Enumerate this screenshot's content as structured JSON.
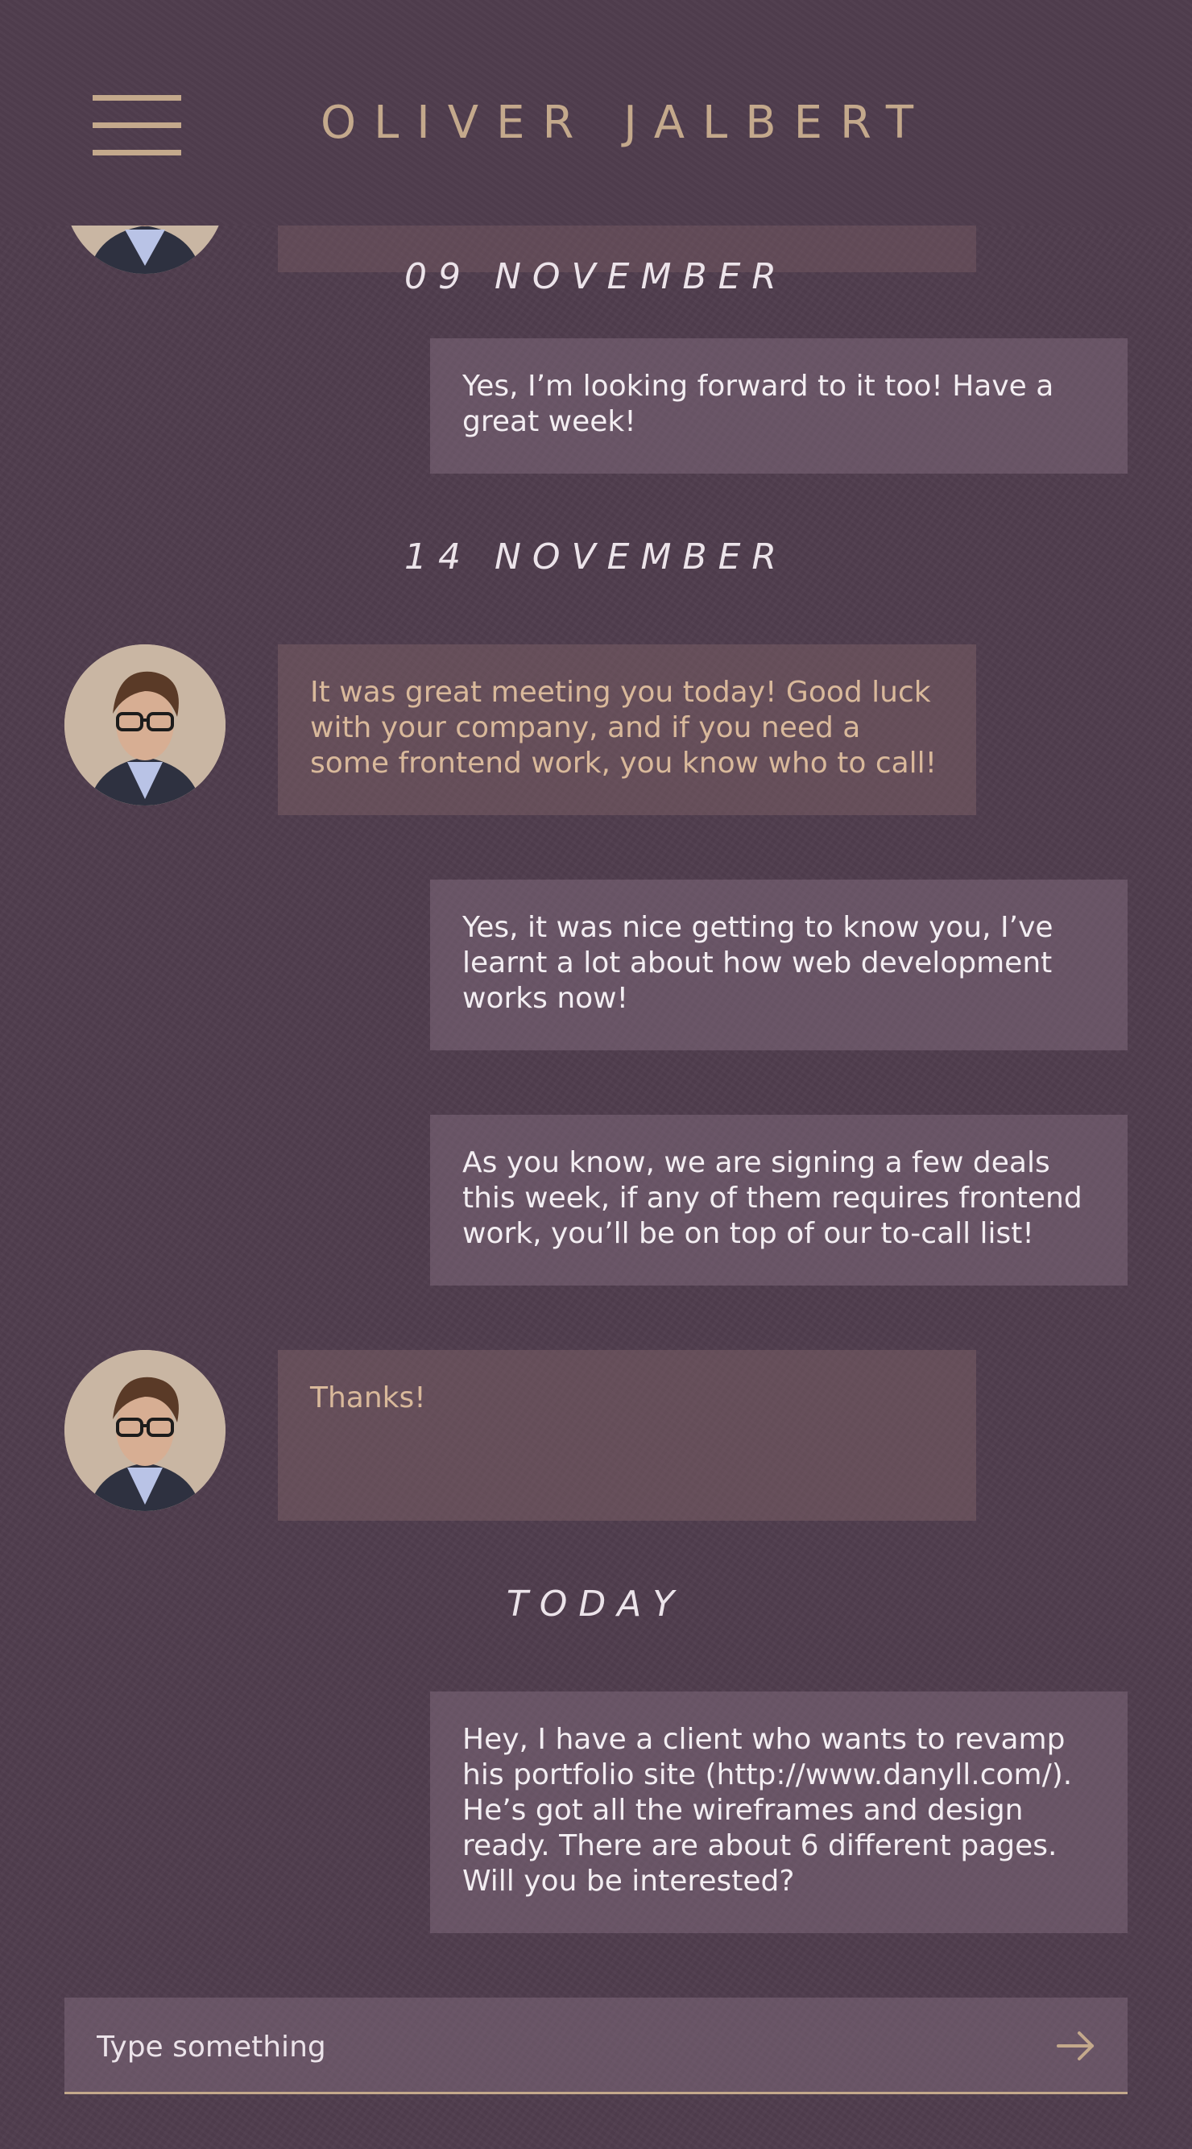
{
  "header": {
    "contact_name": "OLIVER JALBERT",
    "menu_icon": "hamburger-menu-icon"
  },
  "conversation": {
    "groups": [
      {
        "date": "09 NOVEMBER",
        "messages": [
          {
            "direction": "sent",
            "text": "Yes, I’m looking forward to it too! Have a great week!"
          }
        ]
      },
      {
        "date": "14 NOVEMBER",
        "messages": [
          {
            "direction": "received",
            "text": "It was great meeting you today! Good luck with your company, and if you need a some frontend work, you know who to call!"
          },
          {
            "direction": "sent",
            "text": "Yes, it was nice getting to know you, I’ve learnt a lot about how web development works now!"
          },
          {
            "direction": "sent",
            "text": "As you know, we are signing a few deals this week, if any of them requires frontend work, you’ll be on top of our to-call list!"
          },
          {
            "direction": "received",
            "text": "Thanks!"
          }
        ]
      },
      {
        "date": "TODAY",
        "messages": [
          {
            "direction": "sent",
            "text": "Hey, I have a client who wants to revamp his portfolio site (http://www.danyll.com/). He’s got all the wireframes and design ready. There are about 6 different pages. Will you be interested?"
          }
        ]
      }
    ]
  },
  "composer": {
    "placeholder": "Type something",
    "value": "",
    "send_icon": "arrow-right-icon"
  },
  "colors": {
    "background": "#4f3d4d",
    "accent": "#c4a98c",
    "sent_bubble": "#6b5668",
    "received_bubble": "#675058",
    "received_text": "#d9b99b",
    "sent_text": "#f3eef2"
  }
}
